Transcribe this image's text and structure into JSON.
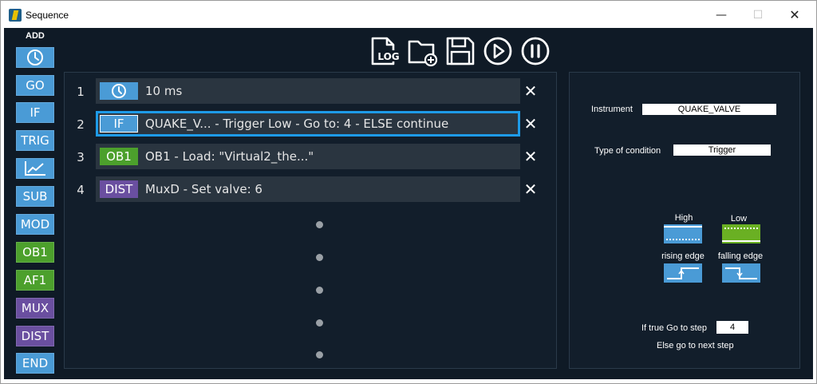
{
  "window": {
    "title": "Sequence",
    "controls": {
      "minimize": "—",
      "maximize": "☐",
      "close": "✕"
    }
  },
  "palette": {
    "header": "ADD",
    "items": [
      {
        "id": "timer",
        "label": "",
        "icon": "clock-icon",
        "color": "#4a9bd6"
      },
      {
        "id": "go",
        "label": "GO",
        "color": "#4a9bd6"
      },
      {
        "id": "if",
        "label": "IF",
        "color": "#4a9bd6"
      },
      {
        "id": "trig",
        "label": "TRIG",
        "color": "#4a9bd6"
      },
      {
        "id": "plot",
        "label": "",
        "icon": "chart-icon",
        "color": "#4a9bd6"
      },
      {
        "id": "sub",
        "label": "SUB",
        "color": "#4a9bd6"
      },
      {
        "id": "mod",
        "label": "MOD",
        "color": "#4a9bd6"
      },
      {
        "id": "ob1",
        "label": "OB1",
        "color": "#4ca02c"
      },
      {
        "id": "af1",
        "label": "AF1",
        "color": "#4ca02c"
      },
      {
        "id": "mux",
        "label": "MUX",
        "color": "#6a4fa0"
      },
      {
        "id": "dist",
        "label": "DIST",
        "color": "#6a4fa0"
      },
      {
        "id": "end",
        "label": "END",
        "color": "#4a9bd6"
      }
    ]
  },
  "toolbar": {
    "log_label": "LOG",
    "icons": [
      "log-file-icon",
      "new-folder-icon",
      "save-icon",
      "play-icon",
      "pause-icon"
    ]
  },
  "steps": [
    {
      "number": "1",
      "badge": "",
      "badge_icon": "clock-icon",
      "badge_color": "#4a9bd6",
      "text": "10 ms",
      "selected": false
    },
    {
      "number": "2",
      "badge": "IF",
      "badge_color": "#4a9bd6",
      "text": "QUAKE_V... - Trigger Low - Go to: 4 - ELSE continue",
      "selected": true
    },
    {
      "number": "3",
      "badge": "OB1",
      "badge_color": "#4ca02c",
      "text": "OB1 - Load: \"Virtual2_the...\"",
      "selected": false
    },
    {
      "number": "4",
      "badge": "DIST",
      "badge_color": "#6a4fa0",
      "text": "MuxD - Set valve: 6",
      "selected": false
    }
  ],
  "delete_label": "✕",
  "properties": {
    "instrument_label": "Instrument",
    "instrument_value": "QUAKE_VALVE",
    "condition_label": "Type of condition",
    "condition_value": "Trigger",
    "high_label": "High",
    "low_label": "Low",
    "rising_label": "rising edge",
    "falling_label": "falling edge",
    "goto_label": "If true Go to step",
    "goto_value": "4",
    "else_label": "Else go to next step"
  },
  "colors": {
    "background": "#0f1a26",
    "panel": "#121e2b",
    "row": "#2a3540",
    "selection": "#1e9be8",
    "blue": "#4a9bd6",
    "green": "#4ca02c",
    "purple": "#6a4fa0",
    "trigger_green": "#6ab023"
  }
}
